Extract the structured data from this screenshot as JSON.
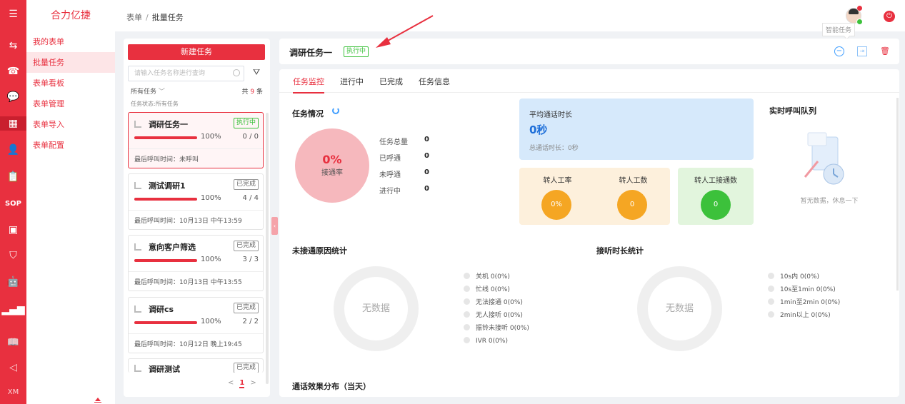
{
  "app": {
    "brand": "合力亿捷"
  },
  "rail": {
    "sop_label": "SOP",
    "xm_label": "XM"
  },
  "menu": {
    "items": [
      {
        "label": "我的表单"
      },
      {
        "label": "批量任务"
      },
      {
        "label": "表单看板"
      },
      {
        "label": "表单管理"
      },
      {
        "label": "表单导入"
      },
      {
        "label": "表单配置"
      }
    ]
  },
  "header": {
    "breadcrumb_root": "表单",
    "breadcrumb_sep": "/",
    "breadcrumb_current": "批量任务",
    "tooltip": "智能任务"
  },
  "task_list": {
    "new_button": "新建任务",
    "search_placeholder": "请输入任务名称进行查询",
    "all_label": "所有任务",
    "count_prefix": "共",
    "count_value": "9",
    "count_suffix": "条",
    "state_line": "任务状态:所有任务",
    "last_call_prefix": "最后呼叫时间：",
    "cards": [
      {
        "name": "调研任务一",
        "status": "执行中",
        "percent": "100%",
        "progress": 1.0,
        "fraction": "0 / 0",
        "last_call": "未呼叫"
      },
      {
        "name": "测试调研1",
        "status": "已完成",
        "percent": "100%",
        "progress": 1.0,
        "fraction": "4 / 4",
        "last_call": "10月13日 中午13:59"
      },
      {
        "name": "意向客户筛选",
        "status": "已完成",
        "percent": "100%",
        "progress": 1.0,
        "fraction": "3 / 3",
        "last_call": "10月13日 中午13:55"
      },
      {
        "name": "调研cs",
        "status": "已完成",
        "percent": "100%",
        "progress": 1.0,
        "fraction": "2 / 2",
        "last_call": "10月12日 晚上19:45"
      },
      {
        "name": "调研测试",
        "status": "已完成"
      }
    ],
    "pager": {
      "prev": "<",
      "page": "1",
      "next": ">"
    }
  },
  "task_header": {
    "title": "调研任务一",
    "status": "执行中"
  },
  "tabs": [
    {
      "label": "任务监控"
    },
    {
      "label": "进行中"
    },
    {
      "label": "已完成"
    },
    {
      "label": "任务信息"
    }
  ],
  "overview": {
    "title": "任务情况",
    "rate_value": "0%",
    "rate_label": "接通率",
    "stats": [
      {
        "label": "任务总量",
        "value": "0"
      },
      {
        "label": "已呼通",
        "value": "0"
      },
      {
        "label": "未呼通",
        "value": "0"
      },
      {
        "label": "进行中",
        "value": "0"
      }
    ]
  },
  "avg_call": {
    "title": "平均通话时长",
    "value": "0秒",
    "total": "总通话时长：0秒"
  },
  "kpis": [
    {
      "label": "转人工率",
      "value": "0%",
      "color": "#f5a623",
      "bg": "#fdf0dc"
    },
    {
      "label": "转人工数",
      "value": "0",
      "color": "#f5a623",
      "bg": "#fdf0dc"
    },
    {
      "label": "转人工接通数",
      "value": "0",
      "color": "#3cc13b",
      "bg": "#e2f5dd"
    }
  ],
  "queue": {
    "title": "实时呼叫队列",
    "empty_text": "暂无数据，休息一下"
  },
  "unconnected": {
    "title": "未接通原因统计",
    "empty": "无数据",
    "legend": [
      "关机   0(0%)",
      "忙线   0(0%)",
      "无法接通   0(0%)",
      "无人接听   0(0%)",
      "振铃未接听   0(0%)",
      "IVR   0(0%)"
    ]
  },
  "duration": {
    "title": "接听时长统计",
    "empty": "无数据",
    "legend": [
      "10s内   0(0%)",
      "10s至1min   0(0%)",
      "1min至2min   0(0%)",
      "2min以上   0(0%)"
    ]
  },
  "effect": {
    "title": "通话效果分布（当天）"
  }
}
